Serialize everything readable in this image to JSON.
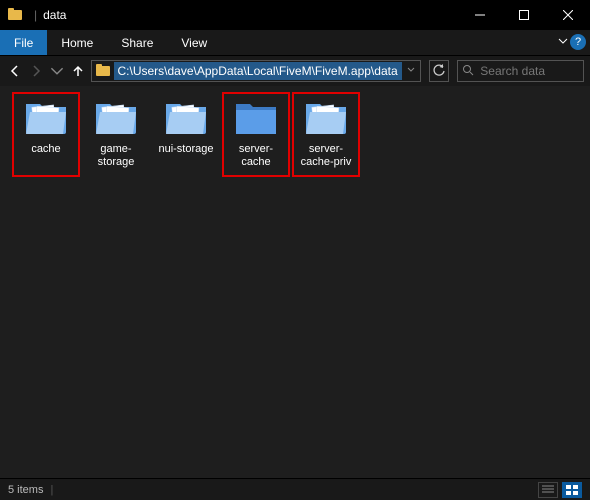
{
  "window": {
    "title": "data",
    "min_label": "Minimize",
    "max_label": "Maximize",
    "close_label": "Close"
  },
  "menu": {
    "file": "File",
    "home": "Home",
    "share": "Share",
    "view": "View"
  },
  "nav": {
    "address_path": "C:\\Users\\dave\\AppData\\Local\\FiveM\\FiveM.app\\data",
    "search_placeholder": "Search data"
  },
  "folders": [
    {
      "name": "cache",
      "has_content": true,
      "highlighted": true
    },
    {
      "name": "game-storage",
      "has_content": true,
      "highlighted": false
    },
    {
      "name": "nui-storage",
      "has_content": true,
      "highlighted": false
    },
    {
      "name": "server-cache",
      "has_content": false,
      "highlighted": true
    },
    {
      "name": "server-cache-priv",
      "has_content": true,
      "highlighted": true
    }
  ],
  "status": {
    "item_count": "5 items"
  }
}
